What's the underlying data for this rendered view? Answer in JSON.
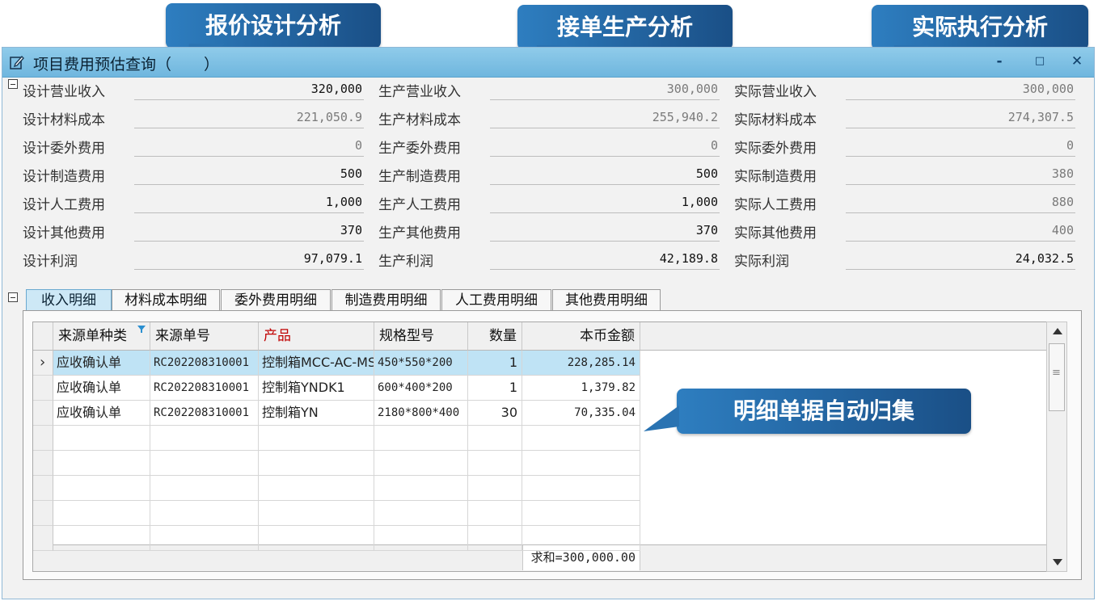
{
  "window": {
    "title": "项目费用预估查询（",
    "title_suffix": "）",
    "minimize": "-",
    "maximize": "□",
    "close": "✕"
  },
  "callouts": {
    "design": "报价设计分析",
    "production": "接单生产分析",
    "actual": "实际执行分析",
    "detail": "明细单据自动归集"
  },
  "summary": {
    "design": [
      {
        "label": "设计营业收入",
        "value": "320,000"
      },
      {
        "label": "设计材料成本",
        "value": "221,050.9"
      },
      {
        "label": "设计委外费用",
        "value": "0"
      },
      {
        "label": "设计制造费用",
        "value": "500"
      },
      {
        "label": "设计人工费用",
        "value": "1,000"
      },
      {
        "label": "设计其他费用",
        "value": "370"
      },
      {
        "label": "设计利润",
        "value": "97,079.1"
      }
    ],
    "production": [
      {
        "label": "生产营业收入",
        "value": "300,000"
      },
      {
        "label": "生产材料成本",
        "value": "255,940.2"
      },
      {
        "label": "生产委外费用",
        "value": "0"
      },
      {
        "label": "生产制造费用",
        "value": "500"
      },
      {
        "label": "生产人工费用",
        "value": "1,000"
      },
      {
        "label": "生产其他费用",
        "value": "370"
      },
      {
        "label": "生产利润",
        "value": "42,189.8"
      }
    ],
    "actual": [
      {
        "label": "实际营业收入",
        "value": "300,000"
      },
      {
        "label": "实际材料成本",
        "value": "274,307.5"
      },
      {
        "label": "实际委外费用",
        "value": "0"
      },
      {
        "label": "实际制造费用",
        "value": "380"
      },
      {
        "label": "实际人工费用",
        "value": "880"
      },
      {
        "label": "实际其他费用",
        "value": "400"
      },
      {
        "label": "实际利润",
        "value": "24,032.5"
      }
    ]
  },
  "tabs": [
    "收入明细",
    "材料成本明细",
    "委外费用明细",
    "制造费用明细",
    "人工费用明细",
    "其他费用明细"
  ],
  "grid": {
    "columns": [
      "来源单种类",
      "来源单号",
      "产品",
      "规格型号",
      "数量",
      "本币金额"
    ],
    "rows": [
      [
        "应收确认单",
        "RC202208310001",
        "控制箱MCC-AC-MS",
        "450*550*200",
        "1",
        "228,285.14"
      ],
      [
        "应收确认单",
        "RC202208310001",
        "控制箱YNDK1",
        "600*400*200",
        "1",
        "1,379.82"
      ],
      [
        "应收确认单",
        "RC202208310001",
        "控制箱YN",
        "2180*800*400",
        "30",
        "70,335.04"
      ]
    ],
    "sum": "求和=300,000.00",
    "row_indicator": "›",
    "scroll_menu": "≡"
  },
  "colors": {
    "accent": "#2e7ec0",
    "header_red": "#c00000",
    "selected_row": "#bfe3f5"
  }
}
